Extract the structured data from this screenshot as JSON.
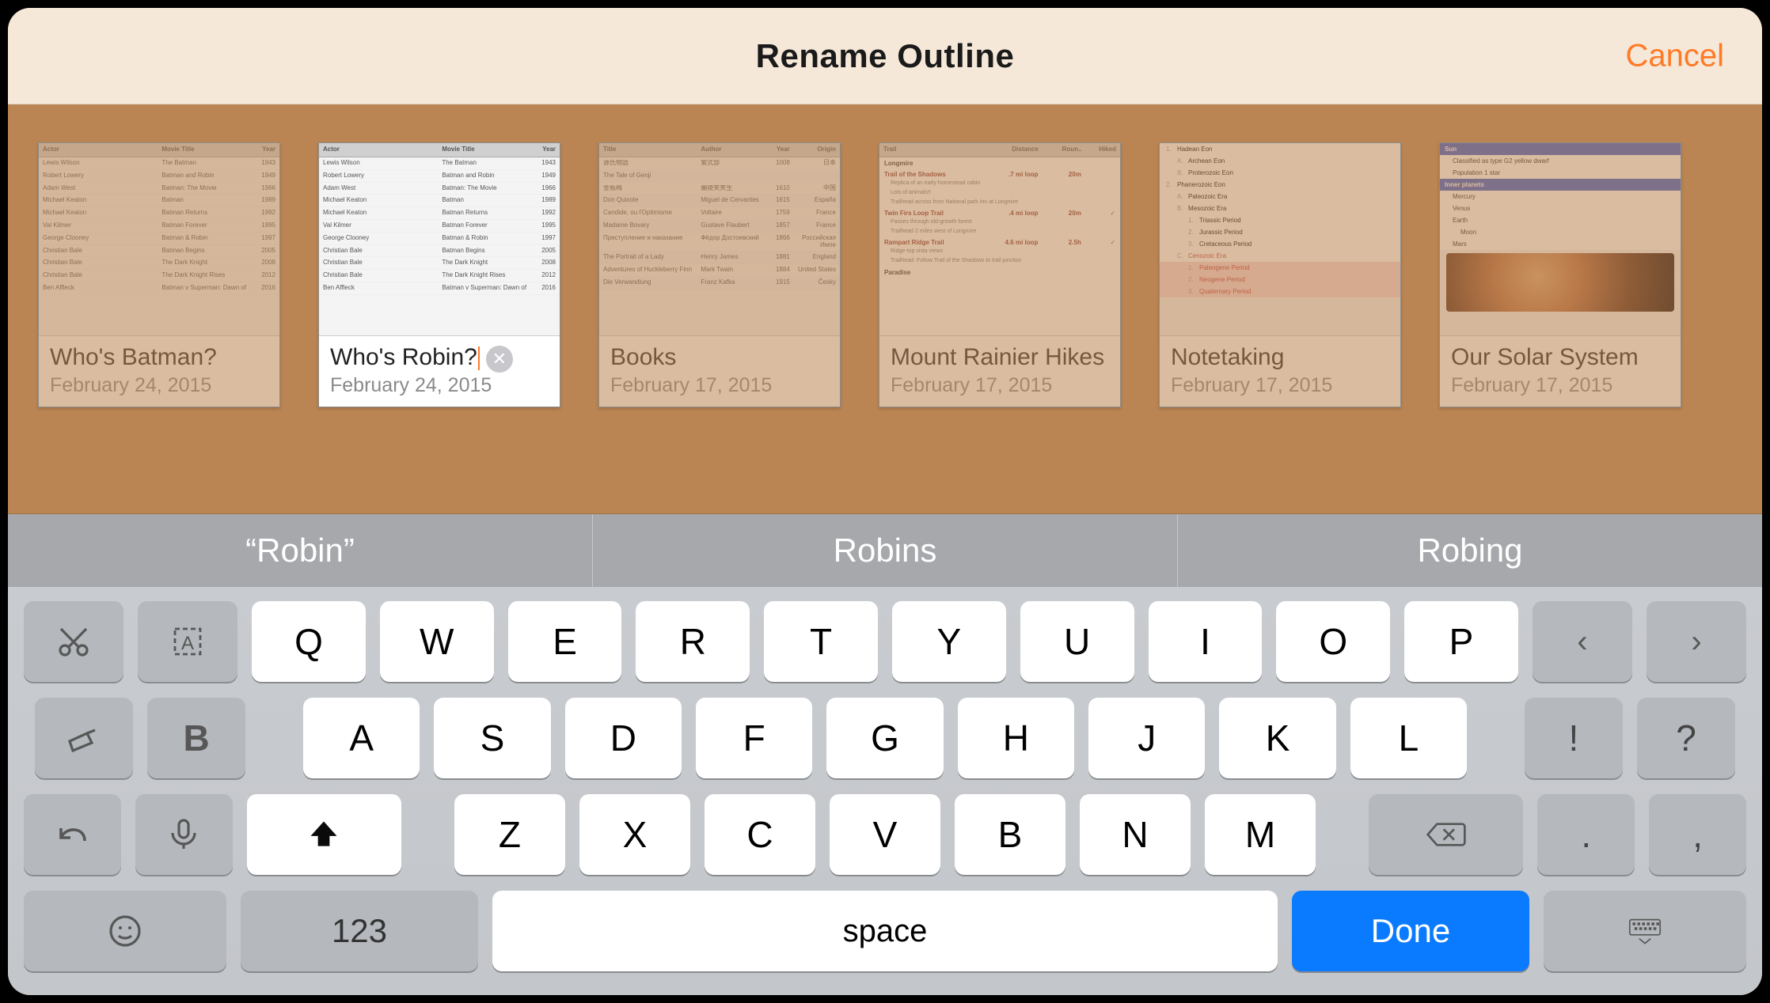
{
  "header": {
    "title": "Rename Outline",
    "cancel": "Cancel"
  },
  "documents": [
    {
      "title": "Who's Batman?",
      "date": "February 24, 2015",
      "selected": false,
      "thumb": "batman"
    },
    {
      "title": "Who's Robin?",
      "date": "February 24, 2015",
      "selected": true,
      "thumb": "batman"
    },
    {
      "title": "Books",
      "date": "February 17, 2015",
      "selected": false,
      "thumb": "books"
    },
    {
      "title": "Mount Rainier Hikes",
      "date": "February 17, 2015",
      "selected": false,
      "thumb": "hikes"
    },
    {
      "title": "Notetaking",
      "date": "February 17, 2015",
      "selected": false,
      "thumb": "notes"
    },
    {
      "title": "Our Solar System",
      "date": "February 17, 2015",
      "selected": false,
      "thumb": "solar"
    }
  ],
  "rename_input_value": "Who's Robin?",
  "suggestions": [
    "“Robin”",
    "Robins",
    "Robing"
  ],
  "keyboard": {
    "row1": [
      "Q",
      "W",
      "E",
      "R",
      "T",
      "Y",
      "U",
      "I",
      "O",
      "P"
    ],
    "row2": [
      "A",
      "S",
      "D",
      "F",
      "G",
      "H",
      "J",
      "K",
      "L"
    ],
    "row3": [
      "Z",
      "X",
      "C",
      "V",
      "B",
      "N",
      "M"
    ],
    "punct_row2": [
      "!",
      "?"
    ],
    "punct_row3": [
      ".",
      ","
    ],
    "numbers_label": "123",
    "space_label": "space",
    "done_label": "Done"
  },
  "thumb_batman": {
    "headers": [
      "Actor",
      "Movie Title",
      "Year"
    ],
    "rows": [
      [
        "Lewis Wilson",
        "The Batman",
        "1943"
      ],
      [
        "Robert Lowery",
        "Batman and Robin",
        "1949"
      ],
      [
        "Adam West",
        "Batman: The Movie",
        "1966"
      ],
      [
        "Michael Keaton",
        "Batman",
        "1989"
      ],
      [
        "Michael Keaton",
        "Batman Returns",
        "1992"
      ],
      [
        "Val Kilmer",
        "Batman Forever",
        "1995"
      ],
      [
        "George Clooney",
        "Batman & Robin",
        "1997"
      ],
      [
        "Christian Bale",
        "Batman Begins",
        "2005"
      ],
      [
        "Christian Bale",
        "The Dark Knight",
        "2008"
      ],
      [
        "Christian Bale",
        "The Dark Knight Rises",
        "2012"
      ],
      [
        "Ben Affleck",
        "Batman v Superman: Dawn of Justice",
        "2016"
      ]
    ]
  },
  "thumb_books": {
    "headers": [
      "Title",
      "Author",
      "Year",
      "Origin"
    ],
    "rows": [
      [
        "源氏物語",
        "紫式部",
        "1008",
        "日本"
      ],
      [
        "The Tale of Genji",
        "",
        "",
        ""
      ],
      [
        "金瓶梅",
        "蘭陵笑笑生",
        "1610",
        "中国"
      ],
      [
        "Don Quixote",
        "Miguel de Cervantes",
        "1615",
        "España"
      ],
      [
        "Candide, ou l'Optimisme",
        "Voltaire",
        "1759",
        "France"
      ],
      [
        "Madame Bovary",
        "Gustave Flaubert",
        "1857",
        "France"
      ],
      [
        "Преступление и наказание",
        "Фёдор Достоевский",
        "1866",
        "Российская Импе"
      ],
      [
        "The Portrait of a Lady",
        "Henry James",
        "1881",
        "England"
      ],
      [
        "Adventures of Huckleberry Finn",
        "Mark Twain",
        "1884",
        "United States"
      ],
      [
        "Die Verwandlung",
        "Franz Kafka",
        "1915",
        "Česky"
      ]
    ]
  },
  "thumb_hikes": {
    "headers": [
      "Trail",
      "Distance",
      "Roun..",
      "Hiked"
    ],
    "sections": [
      {
        "name": "Longmire",
        "trails": [
          {
            "name": "Trail of the Shadows",
            "dist": ".7 mi loop",
            "rt": "20m",
            "hiked": false,
            "notes": [
              "Replica of an early homestead cabin",
              "Lots of animals!!",
              "Trailhead across from National park Inn at Longmire"
            ]
          },
          {
            "name": "Twin Firs Loop Trail",
            "dist": ".4 mi loop",
            "rt": "20m",
            "hiked": true,
            "notes": [
              "Passes through old-growth forest",
              "Trailhead 2 miles west of Longmire"
            ]
          },
          {
            "name": "Rampart Ridge Trail",
            "dist": "4.6 mi loop",
            "rt": "2.5h",
            "hiked": true,
            "notes": [
              "Ridge-top vista views",
              "Trailhead: Follow Trail of the Shadows to trail junction"
            ]
          }
        ]
      },
      {
        "name": "Paradise",
        "trails": []
      }
    ]
  },
  "thumb_notes": {
    "lines": [
      {
        "lvl": 1,
        "num": "1.",
        "text": "Hadean Eon"
      },
      {
        "lvl": 2,
        "num": "A.",
        "text": "Archean Eon"
      },
      {
        "lvl": 2,
        "num": "B.",
        "text": "Proterozoic Eon"
      },
      {
        "lvl": 1,
        "num": "2.",
        "text": "Phanerozoic Eon"
      },
      {
        "lvl": 2,
        "num": "A.",
        "text": "Paleozoic Era"
      },
      {
        "lvl": 2,
        "num": "B.",
        "text": "Mesozoic Era"
      },
      {
        "lvl": 3,
        "num": "1.",
        "text": "Triassic Period"
      },
      {
        "lvl": 3,
        "num": "2.",
        "text": "Jurassic Period"
      },
      {
        "lvl": 3,
        "num": "3.",
        "text": "Cretaceous Period"
      },
      {
        "lvl": 2,
        "num": "C.",
        "text": "Cenozoic Era",
        "red": true
      },
      {
        "lvl": 3,
        "num": "1.",
        "text": "Paleogene Period",
        "red": true,
        "pink": true
      },
      {
        "lvl": 3,
        "num": "2.",
        "text": "Neogene Period",
        "red": true,
        "pink": true
      },
      {
        "lvl": 3,
        "num": "3.",
        "text": "Quaternary Period",
        "red": true,
        "pink": true
      }
    ]
  },
  "thumb_solar": {
    "bars_and_rows": [
      {
        "type": "bar",
        "text": "Sun"
      },
      {
        "type": "row",
        "text": "Classified as type G2 yellow dwarf",
        "i": 1
      },
      {
        "type": "row",
        "text": "Population 1 star",
        "i": 1
      },
      {
        "type": "bar",
        "text": "Inner planets"
      },
      {
        "type": "row",
        "text": "Mercury",
        "i": 1
      },
      {
        "type": "row",
        "text": "Venus",
        "i": 1
      },
      {
        "type": "row",
        "text": "Earth",
        "i": 1
      },
      {
        "type": "row",
        "text": "Moon",
        "i": 2
      },
      {
        "type": "row",
        "text": "Mars",
        "i": 1
      }
    ]
  }
}
